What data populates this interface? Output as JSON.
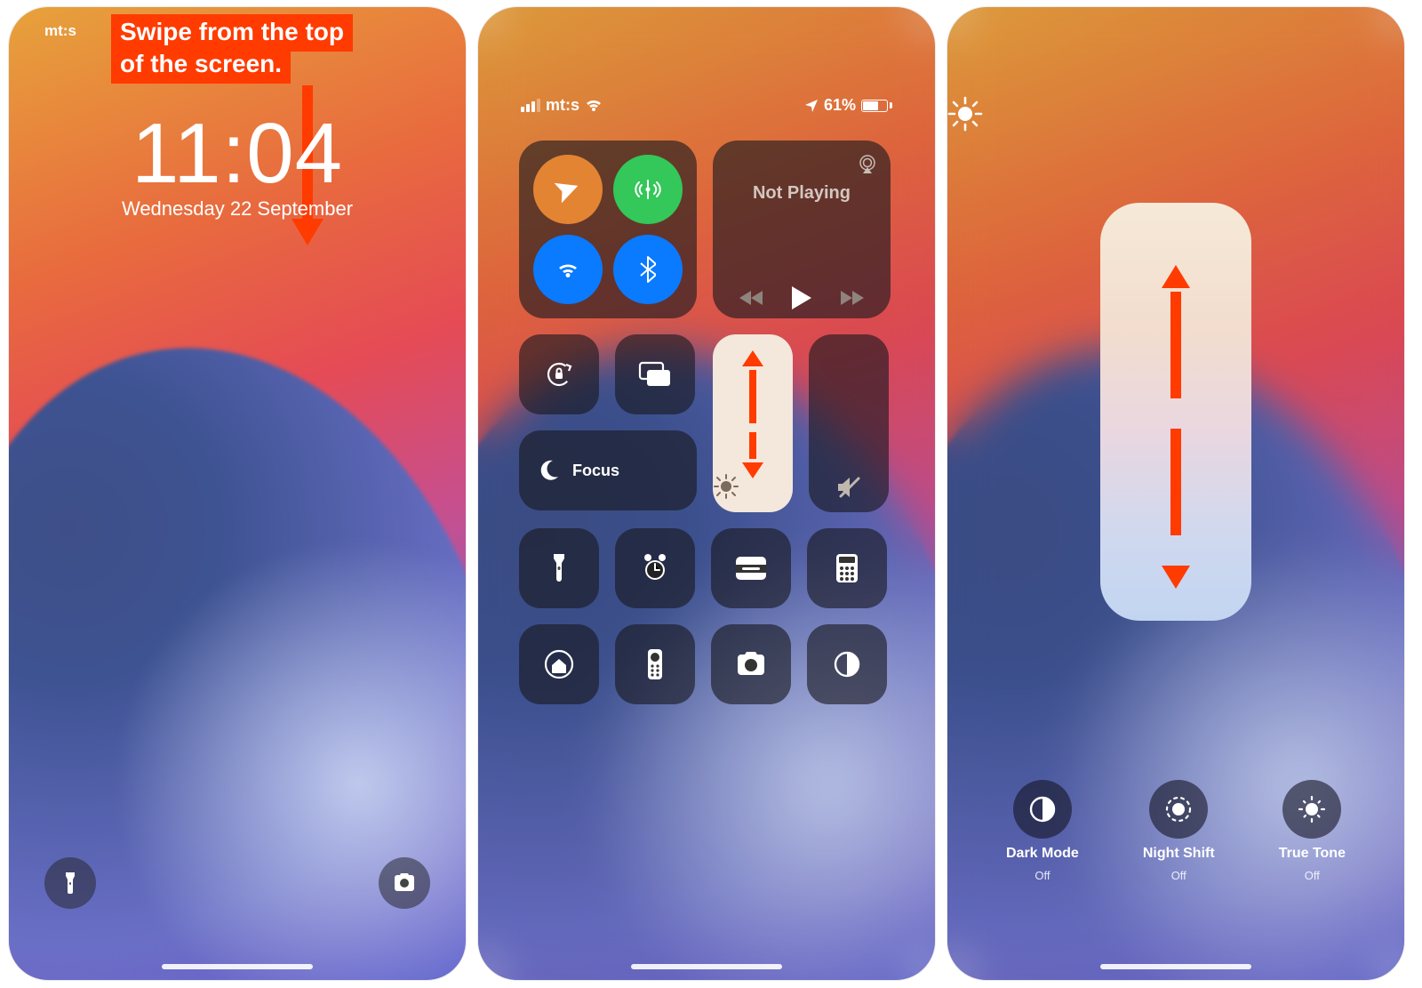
{
  "annotation": {
    "line1": "Swipe from the top",
    "line2": "of the screen."
  },
  "lockscreen": {
    "carrier": "mt:s",
    "time": "11:04",
    "date": "Wednesday 22 September"
  },
  "control_center": {
    "status": {
      "carrier": "mt:s",
      "battery_pct": "61%"
    },
    "media": {
      "title": "Not Playing"
    },
    "focus": {
      "label": "Focus"
    },
    "connectivity": {
      "airplane": {
        "active": true
      },
      "cellular": {
        "active": true
      },
      "wifi": {
        "active": true
      },
      "bluetooth": {
        "active": true
      }
    },
    "tiles": [
      "orientation-lock",
      "screen-mirroring"
    ],
    "brightness_level_pct": 100,
    "volume_level_pct": 0,
    "shortcut_icons": [
      "flashlight",
      "alarm",
      "wallet",
      "calculator",
      "home",
      "apple-tv-remote",
      "camera",
      "dark-mode"
    ]
  },
  "brightness_panel": {
    "options": [
      {
        "key": "dark-mode",
        "label": "Dark Mode",
        "state": "Off"
      },
      {
        "key": "night-shift",
        "label": "Night Shift",
        "state": "Off"
      },
      {
        "key": "true-tone",
        "label": "True Tone",
        "state": "Off"
      }
    ]
  }
}
